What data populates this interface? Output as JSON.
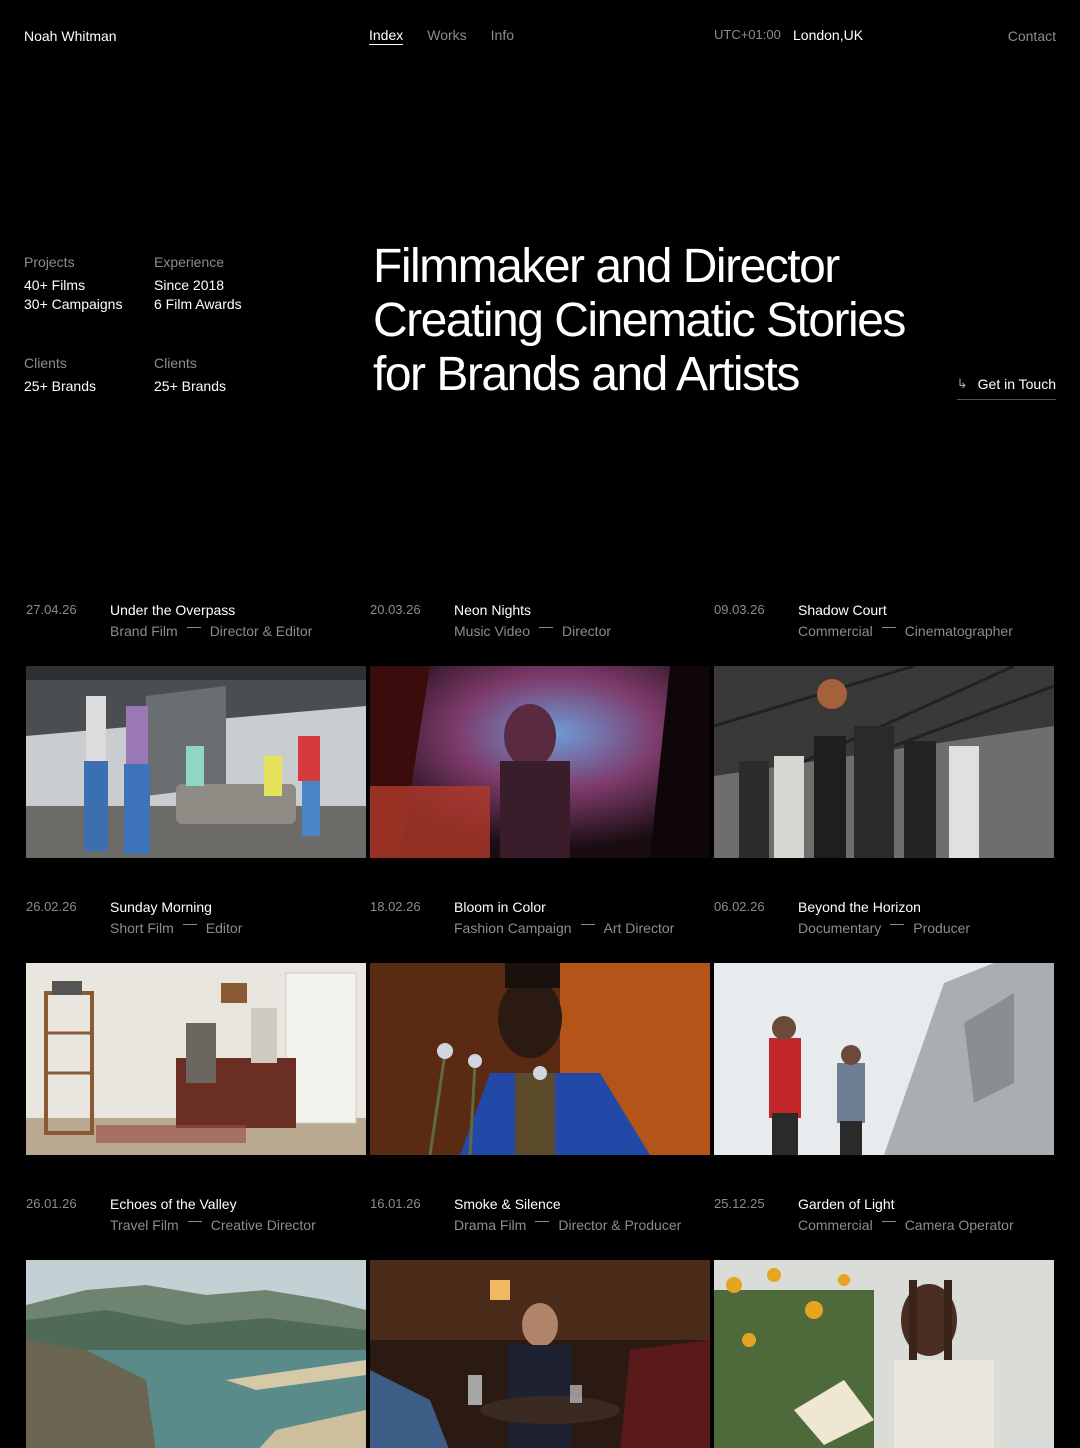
{
  "nav": {
    "brand": "Noah Whitman",
    "links": [
      "Index",
      "Works",
      "Info"
    ],
    "timezone": "UTC+01:00",
    "location": "London,UK",
    "contact": "Contact"
  },
  "stats": [
    {
      "label": "Projects",
      "values": [
        "40+ Films",
        "30+ Campaigns"
      ]
    },
    {
      "label": "Experience",
      "values": [
        "Since 2018",
        "6 Film Awards"
      ]
    },
    {
      "label": "Clients",
      "values": [
        "25+ Brands"
      ]
    },
    {
      "label": "Clients",
      "values": [
        "25+ Brands"
      ]
    }
  ],
  "hero": {
    "lines": [
      "Filmmaker and Director",
      "Creating Cinematic Stories",
      "for Brands and Artists"
    ]
  },
  "cta": {
    "label": "Get in Touch",
    "arrow": "↳"
  },
  "projects": [
    {
      "date": "27.04.26",
      "title": "Under the Overpass",
      "type": "Brand Film",
      "role": "Director & Editor"
    },
    {
      "date": "20.03.26",
      "title": "Neon Nights",
      "type": "Music Video",
      "role": "Director"
    },
    {
      "date": "09.03.26",
      "title": "Shadow Court",
      "type": "Commercial",
      "role": "Cinematographer"
    },
    {
      "date": "26.02.26",
      "title": "Sunday Morning",
      "type": "Short Film",
      "role": "Editor"
    },
    {
      "date": "18.02.26",
      "title": "Bloom in Color",
      "type": "Fashion Campaign",
      "role": "Art Director"
    },
    {
      "date": "06.02.26",
      "title": "Beyond the Horizon",
      "type": "Documentary",
      "role": "Producer"
    },
    {
      "date": "26.01.26",
      "title": "Echoes of the Valley",
      "type": "Travel Film",
      "role": "Creative Director"
    },
    {
      "date": "16.01.26",
      "title": "Smoke & Silence",
      "type": "Drama Film",
      "role": "Director & Producer"
    },
    {
      "date": "25.12.25",
      "title": "Garden of Light",
      "type": "Commercial",
      "role": "Camera Operator"
    }
  ]
}
